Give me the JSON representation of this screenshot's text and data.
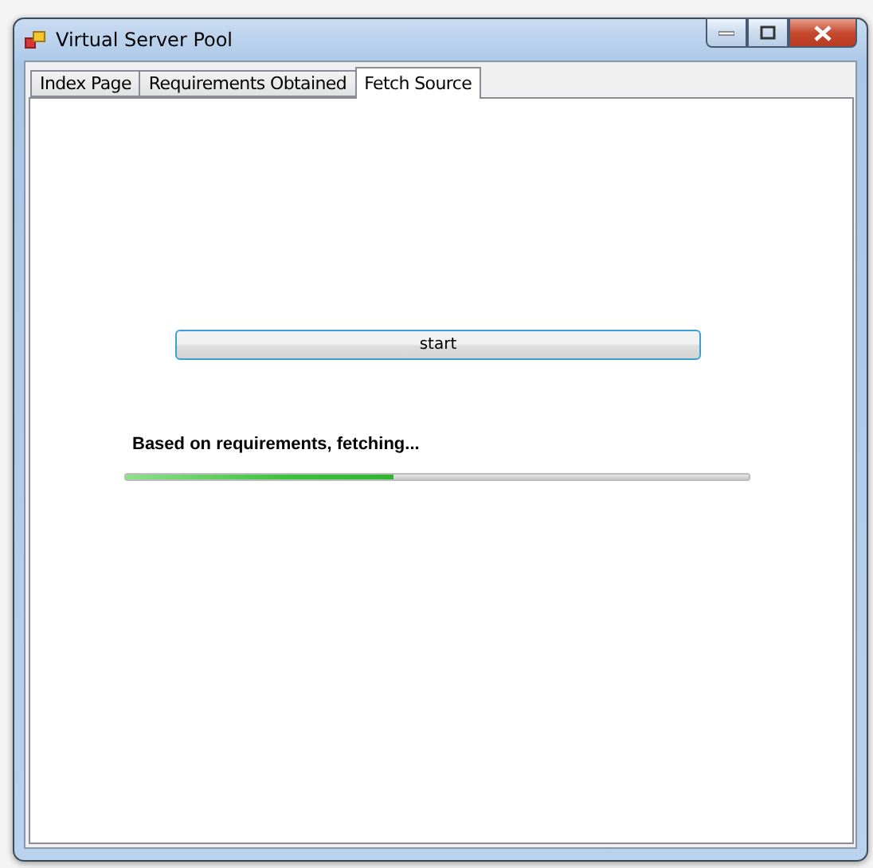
{
  "window": {
    "title": "Virtual Server Pool"
  },
  "tabs": [
    {
      "label": "Index Page",
      "selected": false
    },
    {
      "label": "Requirements Obtained",
      "selected": false
    },
    {
      "label": "Fetch Source",
      "selected": true
    }
  ],
  "start_button": {
    "label": "start"
  },
  "status": {
    "text": "Based on requirements, fetching..."
  },
  "progress": {
    "level": 0.43
  }
}
